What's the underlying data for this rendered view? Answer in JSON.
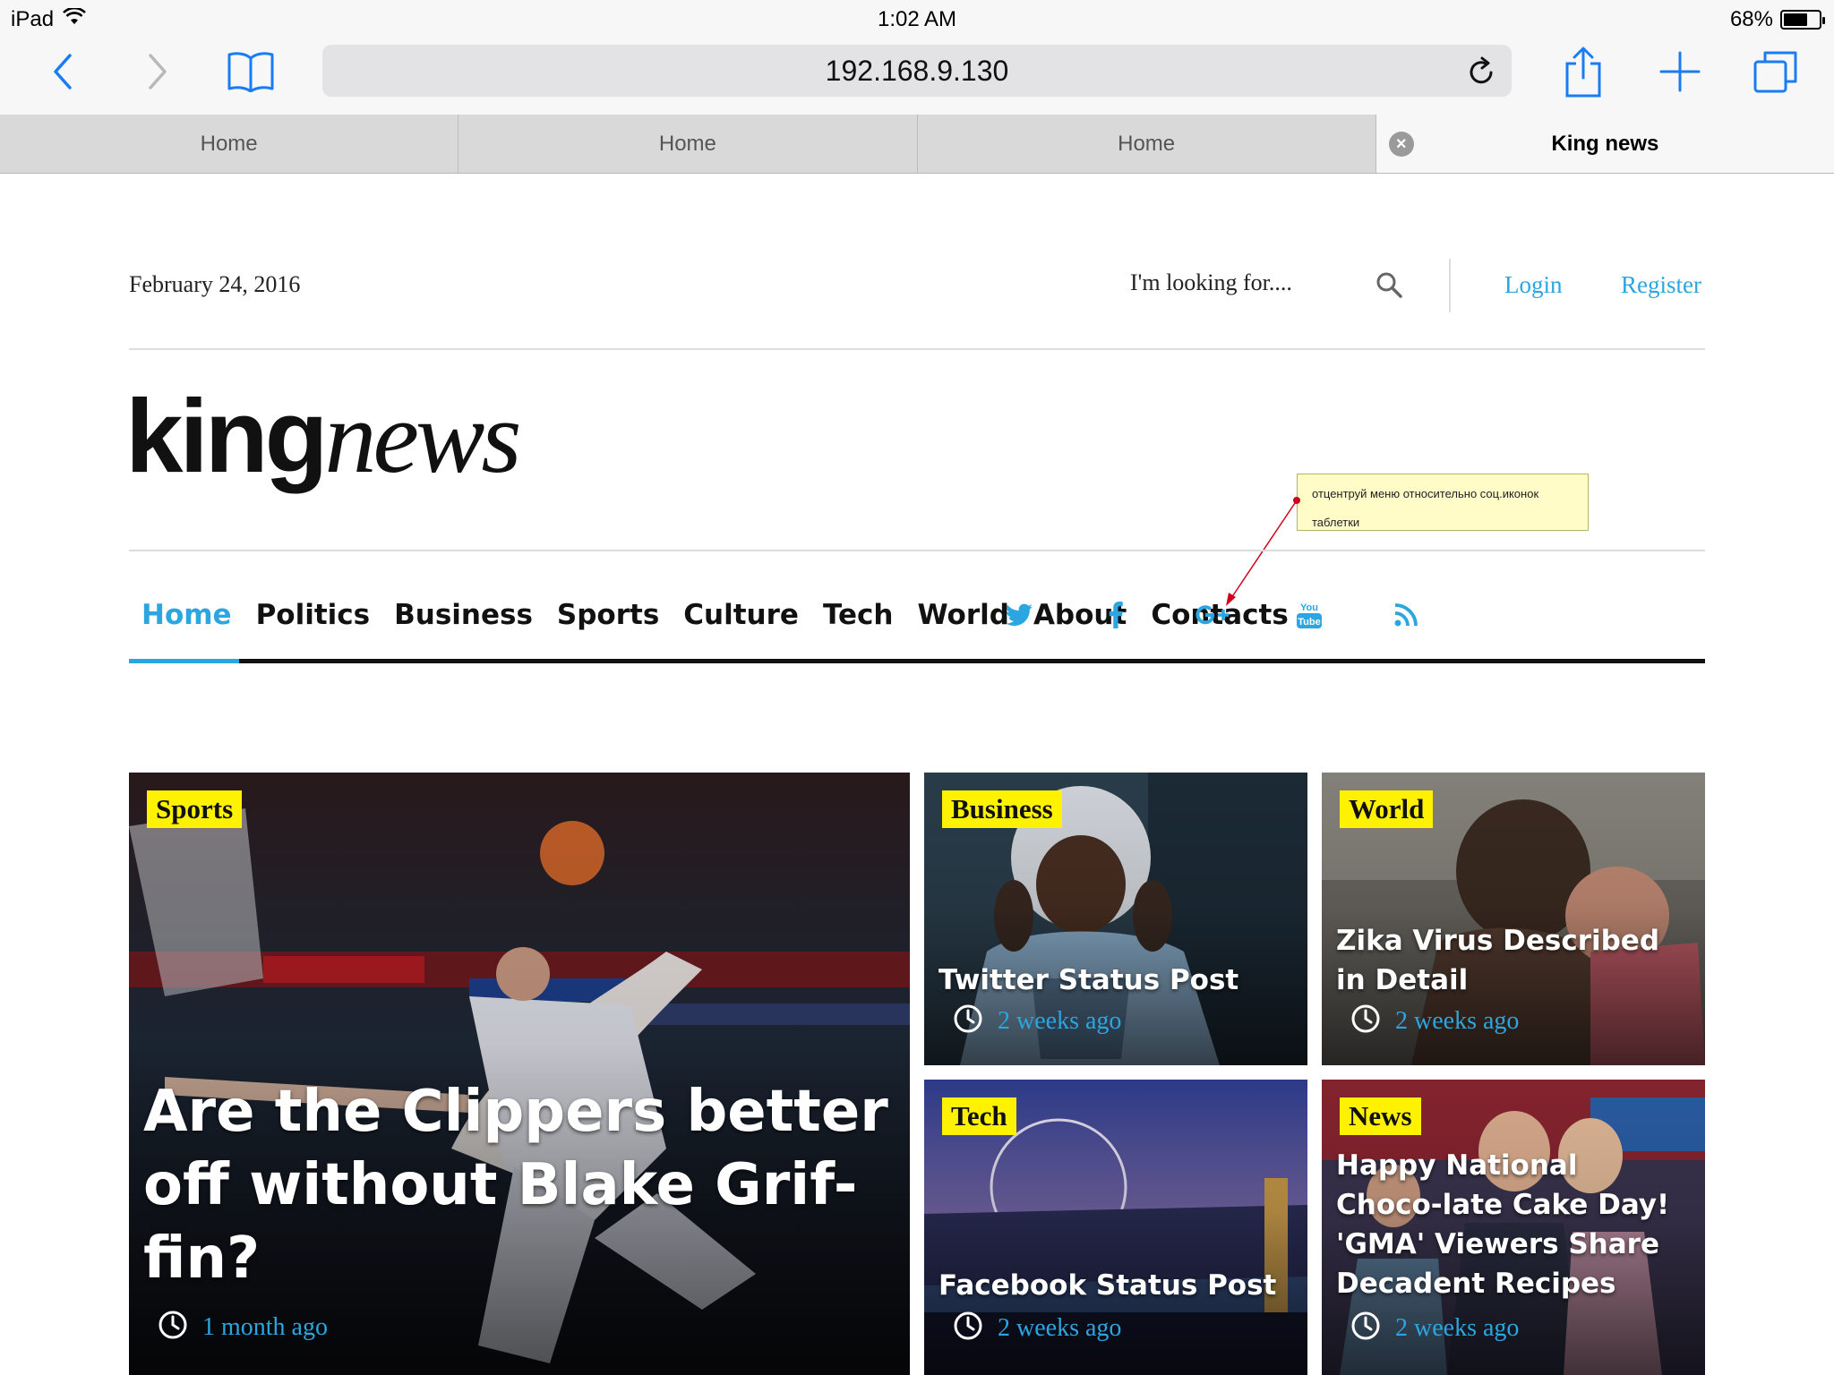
{
  "status": {
    "device": "iPad",
    "time": "1:02 AM",
    "battery": "68%",
    "battery_level": 0.68
  },
  "browser": {
    "url": "192.168.9.130",
    "tabs": [
      {
        "label": "Home"
      },
      {
        "label": "Home"
      },
      {
        "label": "Home"
      },
      {
        "label": "King news"
      }
    ]
  },
  "site": {
    "date": "February 24, 2016",
    "search_placeholder": "I'm looking for....",
    "login": "Login",
    "register": "Register",
    "logo_part1": "king",
    "logo_part2": "news",
    "note_line1": "отцентруй меню относительно соц.иконок",
    "note_line2": "таблетки",
    "nav": [
      "Home",
      "Politics",
      "Business",
      "Sports",
      "Culture",
      "Tech",
      "World",
      "About",
      "Contacts"
    ],
    "socials": [
      "twitter-icon",
      "facebook-icon",
      "google-plus-icon",
      "youtube-icon",
      "rss-icon"
    ],
    "accent": "#2ba6e1",
    "tag_color": "#fff200"
  },
  "articles": [
    {
      "tag": "Sports",
      "title": "Are the Clippers better off without Blake Grif-fin?",
      "time": "1 month ago"
    },
    {
      "tag": "Business",
      "title": "Twitter Status Post",
      "time": "2 weeks ago"
    },
    {
      "tag": "World",
      "title": "Zika Virus Described in Detail",
      "time": "2 weeks ago"
    },
    {
      "tag": "Tech",
      "title": "Facebook Status Post",
      "time": "2 weeks ago"
    },
    {
      "tag": "News",
      "title": "Happy National Choco-late Cake Day! 'GMA' Viewers Share Decadent Recipes",
      "time": "2 weeks ago"
    }
  ]
}
